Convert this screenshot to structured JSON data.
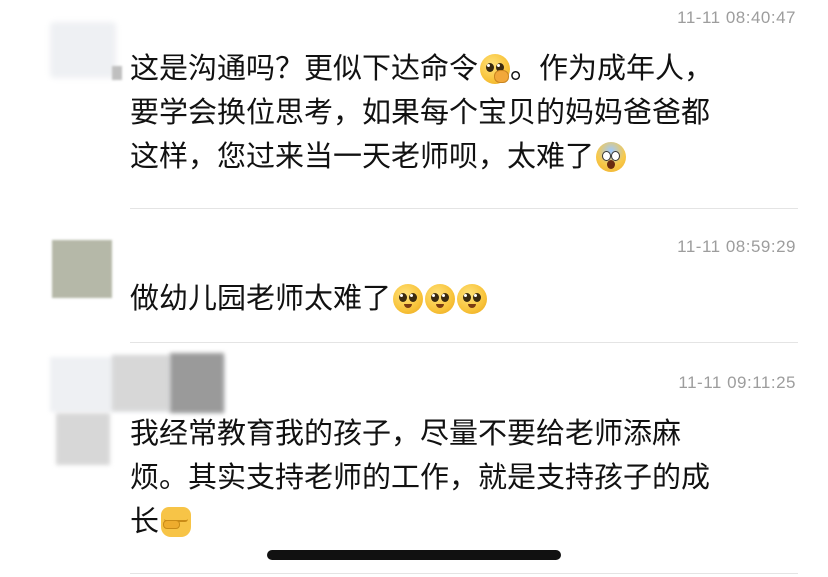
{
  "comments": [
    {
      "timestamp": "11-11 08:40:47",
      "lines": [
        "这是沟通吗？更似下达命令",
        "。作为成年人，",
        "要学会换位思考，如果每个宝贝的妈妈爸爸都",
        "这样，您过来当一天老师呗，太难了"
      ],
      "emojis": [
        "thinking-face-emoji",
        "screaming-face-emoji"
      ]
    },
    {
      "timestamp": "11-11 08:59:29",
      "lines": [
        "做幼儿园老师太难了"
      ],
      "emojis": [
        "pleading-face-emoji",
        "pleading-face-emoji",
        "pleading-face-emoji"
      ]
    },
    {
      "timestamp": "11-11 09:11:25",
      "lines": [
        "我经常教育我的孩子，尽量不要给老师添麻",
        "烦。其实支持老师的工作，就是支持孩子的成",
        "长"
      ],
      "emojis": [
        "raised-fist-emoji"
      ]
    }
  ],
  "colors": {
    "background": "#ffffff",
    "text": "#111111",
    "timestamp": "#9d9d9d",
    "divider": "#e4e4e4",
    "avatar_blur_light": "#eef0f3",
    "avatar_blur_mid": "#d7d7d7",
    "avatar_blur_dark": "#9a9a9a",
    "avatar_green_gray": "#b5b8a8"
  }
}
